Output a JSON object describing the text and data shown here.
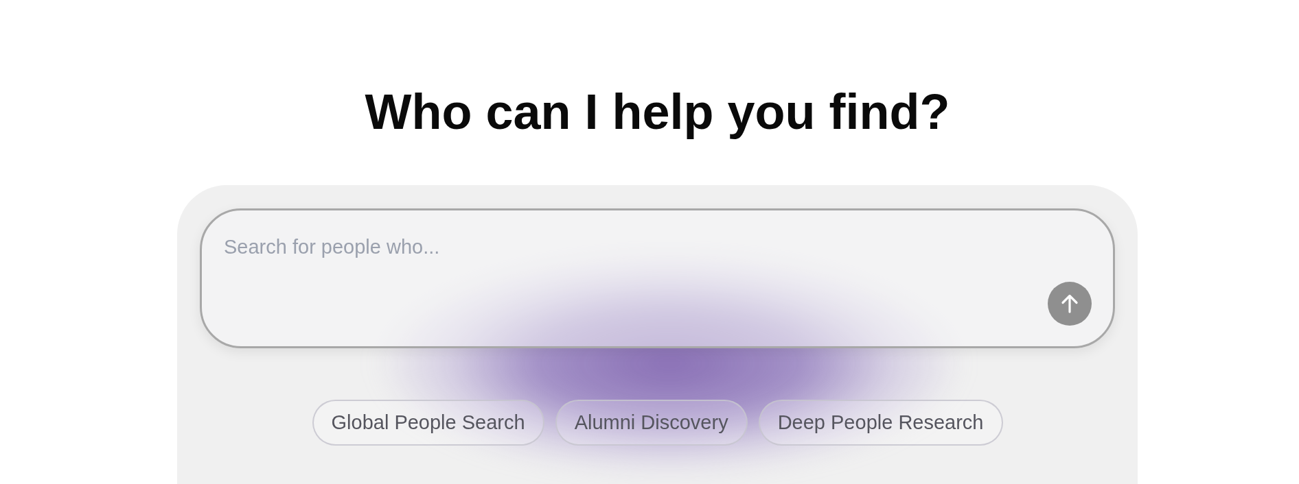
{
  "heading": "Who can I help you find?",
  "search": {
    "placeholder": "Search for people who..."
  },
  "suggestions": [
    {
      "label": "Global People Search"
    },
    {
      "label": "Alumni Discovery"
    },
    {
      "label": "Deep People Research"
    }
  ]
}
